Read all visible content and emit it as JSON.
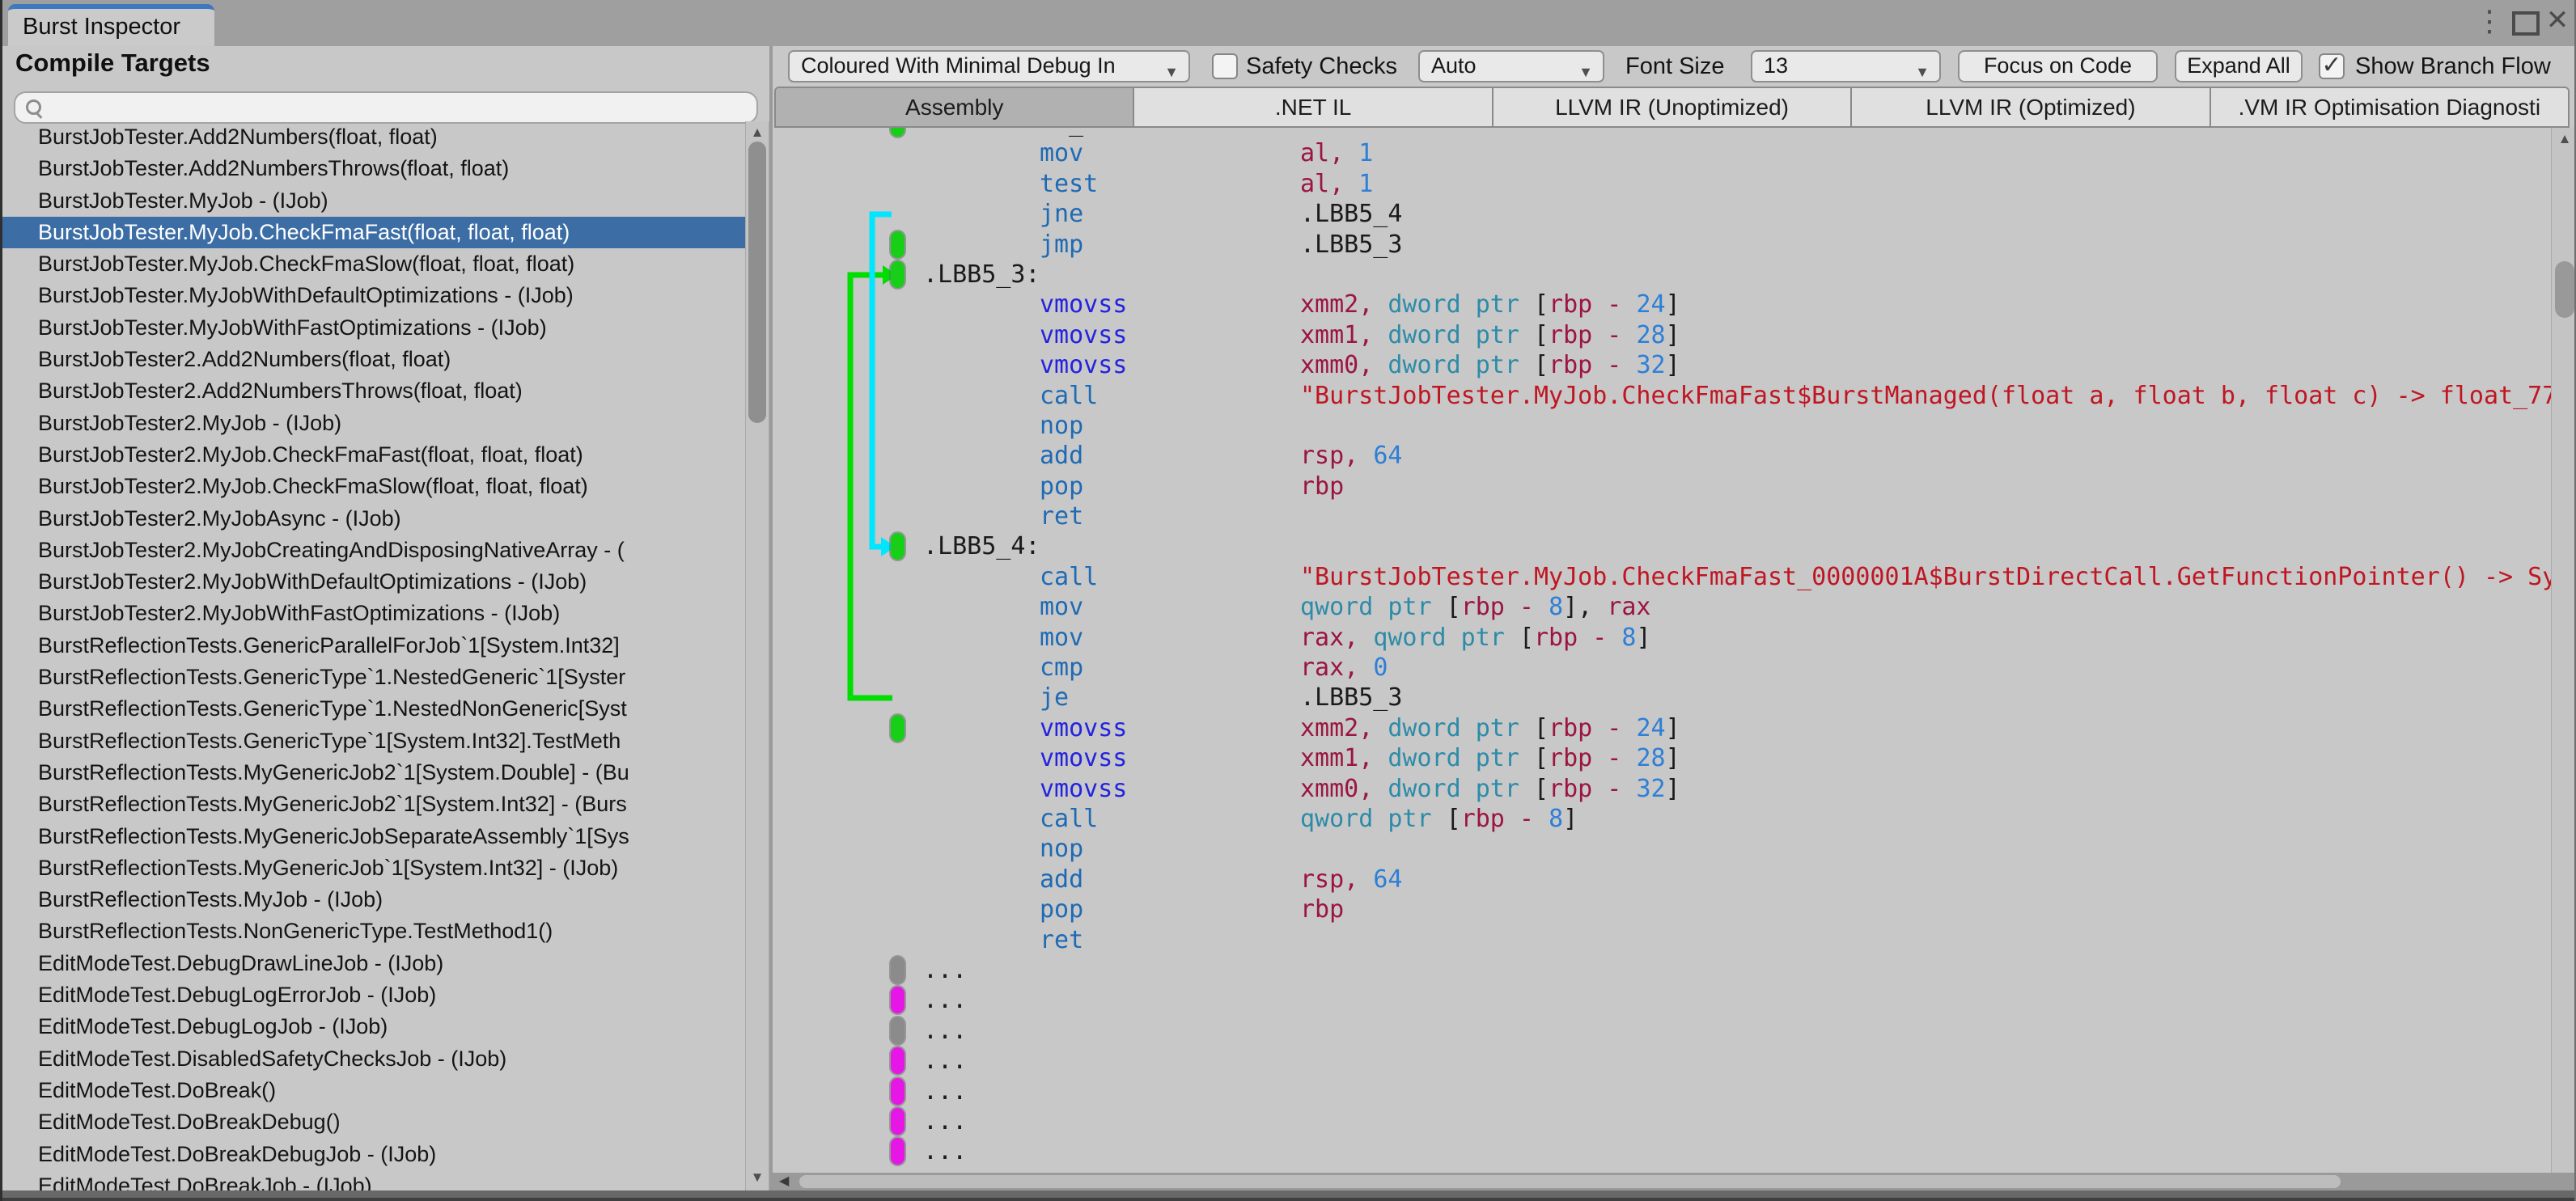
{
  "window": {
    "tab_title": "Burst Inspector"
  },
  "ui": {
    "menu_glyph": "⋮",
    "close_glyph": "✕",
    "dropdown_arrow": "▼",
    "scroll_up": "▲",
    "scroll_down": "▼",
    "scroll_left": "◀",
    "check_glyph": "✓"
  },
  "left_panel": {
    "title": "Compile Targets",
    "search_placeholder": "",
    "selected_index": 3,
    "selection_color": "#3c6ea5",
    "items": [
      "BurstJobTester.Add2Numbers(float, float)",
      "BurstJobTester.Add2NumbersThrows(float, float)",
      "BurstJobTester.MyJob - (IJob)",
      "BurstJobTester.MyJob.CheckFmaFast(float, float, float)",
      "BurstJobTester.MyJob.CheckFmaSlow(float, float, float)",
      "BurstJobTester.MyJobWithDefaultOptimizations - (IJob)",
      "BurstJobTester.MyJobWithFastOptimizations - (IJob)",
      "BurstJobTester2.Add2Numbers(float, float)",
      "BurstJobTester2.Add2NumbersThrows(float, float)",
      "BurstJobTester2.MyJob - (IJob)",
      "BurstJobTester2.MyJob.CheckFmaFast(float, float, float)",
      "BurstJobTester2.MyJob.CheckFmaSlow(float, float, float)",
      "BurstJobTester2.MyJobAsync - (IJob)",
      "BurstJobTester2.MyJobCreatingAndDisposingNativeArray - (",
      "BurstJobTester2.MyJobWithDefaultOptimizations - (IJob)",
      "BurstJobTester2.MyJobWithFastOptimizations - (IJob)",
      "BurstReflectionTests.GenericParallelForJob`1[System.Int32]",
      "BurstReflectionTests.GenericType`1.NestedGeneric`1[Syster",
      "BurstReflectionTests.GenericType`1.NestedNonGeneric[Syst",
      "BurstReflectionTests.GenericType`1[System.Int32].TestMeth",
      "BurstReflectionTests.MyGenericJob2`1[System.Double] - (Bu",
      "BurstReflectionTests.MyGenericJob2`1[System.Int32] - (Burs",
      "BurstReflectionTests.MyGenericJobSeparateAssembly`1[Sys",
      "BurstReflectionTests.MyGenericJob`1[System.Int32] - (IJob)",
      "BurstReflectionTests.MyJob - (IJob)",
      "BurstReflectionTests.NonGenericType.TestMethod1()",
      "EditModeTest.DebugDrawLineJob - (IJob)",
      "EditModeTest.DebugLogErrorJob - (IJob)",
      "EditModeTest.DebugLogJob - (IJob)",
      "EditModeTest.DisabledSafetyChecksJob - (IJob)",
      "EditModeTest.DoBreak()",
      "EditModeTest.DoBreakDebug()",
      "EditModeTest.DoBreakDebugJob - (IJob)",
      "EditModeTest.DoBreakJob - (IJob)"
    ]
  },
  "toolbar": {
    "code_gen_dropdown": "Coloured With Minimal Debug In",
    "safety_checks_label": "Safety Checks",
    "safety_checks_checked": false,
    "target_dropdown": "Auto",
    "font_size_label": "Font Size",
    "font_size_value": "13",
    "focus_button": "Focus on Code",
    "expand_button": "Expand All",
    "branch_flow_label": "Show Branch Flow",
    "branch_flow_checked": true
  },
  "tabs": [
    {
      "label": "Assembly",
      "selected": true
    },
    {
      "label": ".NET IL",
      "selected": false
    },
    {
      "label": "LLVM IR (Unoptimized)",
      "selected": false
    },
    {
      "label": "LLVM IR (Optimized)",
      "selected": false
    },
    {
      "label": ".VM IR Optimisation Diagnosti",
      "selected": false
    }
  ],
  "code": {
    "colors": {
      "ins": "#1e6ab4",
      "vex": "#2323df",
      "reg": "#9b1540",
      "num": "#2e7fd6",
      "kw": "#2d8ba8",
      "blk": "#1b1b1b",
      "str": "#bf1622",
      "branch_green": "#00dd00",
      "branch_cyan": "#00e6ff",
      "marker_green": "#17cf17",
      "marker_gray": "#8b8b8b",
      "marker_magenta": "#e617e6"
    },
    "lines": [
      {
        "marker": "green",
        "frag": "_"
      },
      {
        "mnem": [
          "mov",
          "ins"
        ],
        "ops": [
          [
            "al, ",
            "reg"
          ],
          [
            "1",
            "num"
          ]
        ]
      },
      {
        "mnem": [
          "test",
          "ins"
        ],
        "ops": [
          [
            "al, ",
            "reg"
          ],
          [
            "1",
            "num"
          ]
        ]
      },
      {
        "mnem": [
          "jne",
          "ins"
        ],
        "ops": [
          [
            ".LBB5_4",
            "blk"
          ]
        ]
      },
      {
        "marker": "green",
        "mnem": [
          "jmp",
          "ins"
        ],
        "ops": [
          [
            ".LBB5_3",
            "blk"
          ]
        ]
      },
      {
        "marker": "green",
        "label": ".LBB5_3:"
      },
      {
        "mnem": [
          "vmovss",
          "vex"
        ],
        "ops": [
          [
            "xmm2, ",
            "reg"
          ],
          [
            "dword ptr ",
            "kw"
          ],
          [
            "[",
            "blk"
          ],
          [
            "rbp - ",
            "reg"
          ],
          [
            "24",
            "num"
          ],
          [
            "]",
            "blk"
          ]
        ]
      },
      {
        "mnem": [
          "vmovss",
          "vex"
        ],
        "ops": [
          [
            "xmm1, ",
            "reg"
          ],
          [
            "dword ptr ",
            "kw"
          ],
          [
            "[",
            "blk"
          ],
          [
            "rbp - ",
            "reg"
          ],
          [
            "28",
            "num"
          ],
          [
            "]",
            "blk"
          ]
        ]
      },
      {
        "mnem": [
          "vmovss",
          "vex"
        ],
        "ops": [
          [
            "xmm0, ",
            "reg"
          ],
          [
            "dword ptr ",
            "kw"
          ],
          [
            "[",
            "blk"
          ],
          [
            "rbp - ",
            "reg"
          ],
          [
            "32",
            "num"
          ],
          [
            "]",
            "blk"
          ]
        ]
      },
      {
        "mnem": [
          "call",
          "ins"
        ],
        "ops": [
          [
            "\"BurstJobTester.MyJob.CheckFmaFast$BurstManaged(float a, float b, float c) -> float_77",
            "str"
          ]
        ]
      },
      {
        "mnem": [
          "nop",
          "ins"
        ],
        "ops": []
      },
      {
        "mnem": [
          "add",
          "ins"
        ],
        "ops": [
          [
            "rsp, ",
            "reg"
          ],
          [
            "64",
            "num"
          ]
        ]
      },
      {
        "mnem": [
          "pop",
          "ins"
        ],
        "ops": [
          [
            "rbp",
            "reg"
          ]
        ]
      },
      {
        "mnem": [
          "ret",
          "ins"
        ],
        "ops": []
      },
      {
        "marker": "green",
        "label": ".LBB5_4:"
      },
      {
        "mnem": [
          "call",
          "ins"
        ],
        "ops": [
          [
            "\"BurstJobTester.MyJob.CheckFmaFast_0000001A$BurstDirectCall.GetFunctionPointer() -> Sy",
            "str"
          ]
        ]
      },
      {
        "mnem": [
          "mov",
          "ins"
        ],
        "ops": [
          [
            "qword ptr ",
            "kw"
          ],
          [
            "[",
            "blk"
          ],
          [
            "rbp - ",
            "reg"
          ],
          [
            "8",
            "num"
          ],
          [
            "], ",
            "blk"
          ],
          [
            "rax",
            "reg"
          ]
        ]
      },
      {
        "mnem": [
          "mov",
          "ins"
        ],
        "ops": [
          [
            "rax, ",
            "reg"
          ],
          [
            "qword ptr ",
            "kw"
          ],
          [
            "[",
            "blk"
          ],
          [
            "rbp - ",
            "reg"
          ],
          [
            "8",
            "num"
          ],
          [
            "]",
            "blk"
          ]
        ]
      },
      {
        "mnem": [
          "cmp",
          "ins"
        ],
        "ops": [
          [
            "rax, ",
            "reg"
          ],
          [
            "0",
            "num"
          ]
        ]
      },
      {
        "mnem": [
          "je",
          "ins"
        ],
        "ops": [
          [
            ".LBB5_3",
            "blk"
          ]
        ]
      },
      {
        "marker": "green",
        "mnem": [
          "vmovss",
          "vex"
        ],
        "ops": [
          [
            "xmm2, ",
            "reg"
          ],
          [
            "dword ptr ",
            "kw"
          ],
          [
            "[",
            "blk"
          ],
          [
            "rbp - ",
            "reg"
          ],
          [
            "24",
            "num"
          ],
          [
            "]",
            "blk"
          ]
        ]
      },
      {
        "mnem": [
          "vmovss",
          "vex"
        ],
        "ops": [
          [
            "xmm1, ",
            "reg"
          ],
          [
            "dword ptr ",
            "kw"
          ],
          [
            "[",
            "blk"
          ],
          [
            "rbp - ",
            "reg"
          ],
          [
            "28",
            "num"
          ],
          [
            "]",
            "blk"
          ]
        ]
      },
      {
        "mnem": [
          "vmovss",
          "vex"
        ],
        "ops": [
          [
            "xmm0, ",
            "reg"
          ],
          [
            "dword ptr ",
            "kw"
          ],
          [
            "[",
            "blk"
          ],
          [
            "rbp - ",
            "reg"
          ],
          [
            "32",
            "num"
          ],
          [
            "]",
            "blk"
          ]
        ]
      },
      {
        "mnem": [
          "call",
          "ins"
        ],
        "ops": [
          [
            "qword ptr ",
            "kw"
          ],
          [
            "[",
            "blk"
          ],
          [
            "rbp - ",
            "reg"
          ],
          [
            "8",
            "num"
          ],
          [
            "]",
            "blk"
          ]
        ]
      },
      {
        "mnem": [
          "nop",
          "ins"
        ],
        "ops": []
      },
      {
        "mnem": [
          "add",
          "ins"
        ],
        "ops": [
          [
            "rsp, ",
            "reg"
          ],
          [
            "64",
            "num"
          ]
        ]
      },
      {
        "mnem": [
          "pop",
          "ins"
        ],
        "ops": [
          [
            "rbp",
            "reg"
          ]
        ]
      },
      {
        "mnem": [
          "ret",
          "ins"
        ],
        "ops": []
      },
      {
        "marker": "gray",
        "dots": "..."
      },
      {
        "marker": "magenta",
        "dots": "..."
      },
      {
        "marker": "gray",
        "dots": "..."
      },
      {
        "marker": "magenta",
        "dots": "..."
      },
      {
        "marker": "magenta",
        "dots": "..."
      },
      {
        "marker": "magenta",
        "dots": "..."
      },
      {
        "marker": "magenta",
        "dots": "..."
      }
    ]
  }
}
